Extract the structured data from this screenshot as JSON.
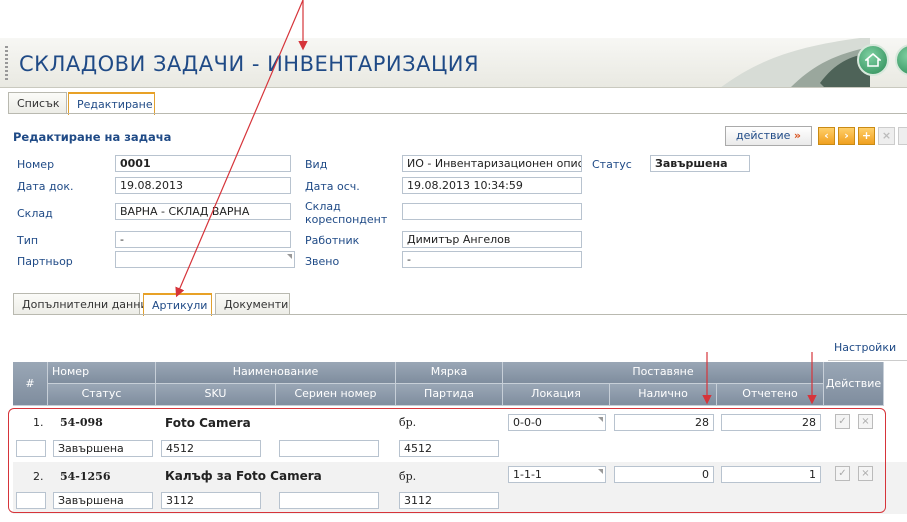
{
  "app": {
    "title": "СКЛАДОВИ ЗАДАЧИ - ИНВЕНТАРИЗАЦИЯ",
    "home_icon": "home-icon"
  },
  "top_tabs": [
    {
      "label": "Списък",
      "active": false
    },
    {
      "label": "Редактиране",
      "active": true
    }
  ],
  "form": {
    "title": "Редактиране на задача",
    "action_button": "действие",
    "fields": {
      "number_label": "Номер",
      "number_value": "0001",
      "doc_date_label": "Дата док.",
      "doc_date_value": "19.08.2013",
      "warehouse_label": "Склад",
      "warehouse_value": "ВАРНА - СКЛАД ВАРНА",
      "type_label": "Тип",
      "type_value": "-",
      "partner_label": "Партньор",
      "partner_value": "",
      "kind_label": "Вид",
      "kind_value": "ИО - Инвентаризационен опис",
      "acc_date_label": "Дата осч.",
      "acc_date_value": "19.08.2013 10:34:59",
      "corr_wh_label_1": "Склад",
      "corr_wh_label_2": "кореспондент",
      "corr_wh_value": "",
      "worker_label": "Работник",
      "worker_value": "Димитър Ангелов",
      "unit_label": "Звено",
      "unit_value": "-",
      "status_label": "Статус",
      "status_value": "Завършена"
    }
  },
  "sub_tabs": [
    {
      "label": "Допълнителни данни",
      "active": false
    },
    {
      "label": "Артикули",
      "active": true
    },
    {
      "label": "Документи",
      "active": false
    }
  ],
  "settings_link": "Настройки",
  "grid": {
    "headers": {
      "hash": "#",
      "number": "Номер",
      "name": "Наименование",
      "unit": "Мярка",
      "placement": "Поставяне",
      "action": "Действие",
      "status": "Статус",
      "sku": "SKU",
      "serial": "Сериен номер",
      "batch": "Партида",
      "location": "Локация",
      "available": "Налично",
      "counted": "Отчетено"
    },
    "rows": [
      {
        "idx": "1.",
        "number": "54-098",
        "name": "Foto Camera",
        "unit": "бр.",
        "location": "0-0-0",
        "available": "28",
        "counted": "28",
        "status": "Завършена",
        "sku": "4512",
        "serial": "",
        "batch": "4512"
      },
      {
        "idx": "2.",
        "number": "54-1256",
        "name": "Калъф за Foto Camera",
        "unit": "бр.",
        "location": "1-1-1",
        "available": "0",
        "counted": "1",
        "status": "Завършена",
        "sku": "3112",
        "serial": "",
        "batch": "3112"
      }
    ]
  },
  "colors": {
    "accent": "#1f4a86",
    "tab_active": "#e8a126",
    "annotation": "#d6343a"
  }
}
